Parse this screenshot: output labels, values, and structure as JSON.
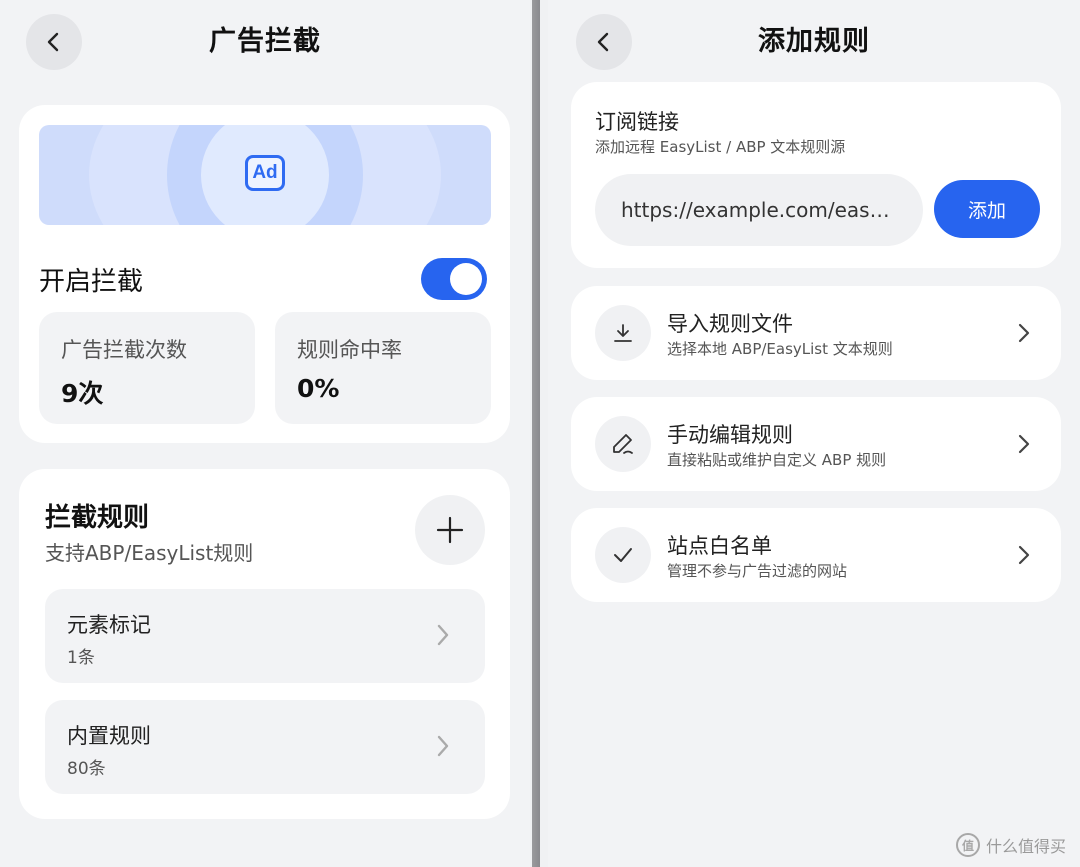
{
  "left": {
    "title": "广告拦截",
    "banner": {
      "icon_text": "Ad"
    },
    "toggle": {
      "label": "开启拦截",
      "on": true
    },
    "stats": [
      {
        "label": "广告拦截次数",
        "value": "9次"
      },
      {
        "label": "规则命中率",
        "value": "0%"
      }
    ],
    "rules_section": {
      "title": "拦截规则",
      "subtitle": "支持ABP/EasyList规则",
      "items": [
        {
          "name": "元素标记",
          "count": "1条"
        },
        {
          "name": "内置规则",
          "count": "80条"
        }
      ]
    }
  },
  "right": {
    "title": "添加规则",
    "subscription": {
      "title": "订阅链接",
      "desc": "添加远程 EasyList / ABP 文本规则源",
      "input_value": "https://example.com/eas…",
      "add_label": "添加"
    },
    "options": [
      {
        "icon": "download-icon",
        "title": "导入规则文件",
        "desc": "选择本地 ABP/EasyList 文本规则"
      },
      {
        "icon": "pen-icon",
        "title": "手动编辑规则",
        "desc": "直接粘贴或维护自定义 ABP 规则"
      },
      {
        "icon": "check-icon",
        "title": "站点白名单",
        "desc": "管理不参与广告过滤的网站"
      }
    ]
  },
  "watermark": {
    "logo_text": "值",
    "text": "什么值得买"
  },
  "colors": {
    "accent": "#2764ef",
    "bg": "#f2f3f5",
    "card": "#ffffff"
  }
}
